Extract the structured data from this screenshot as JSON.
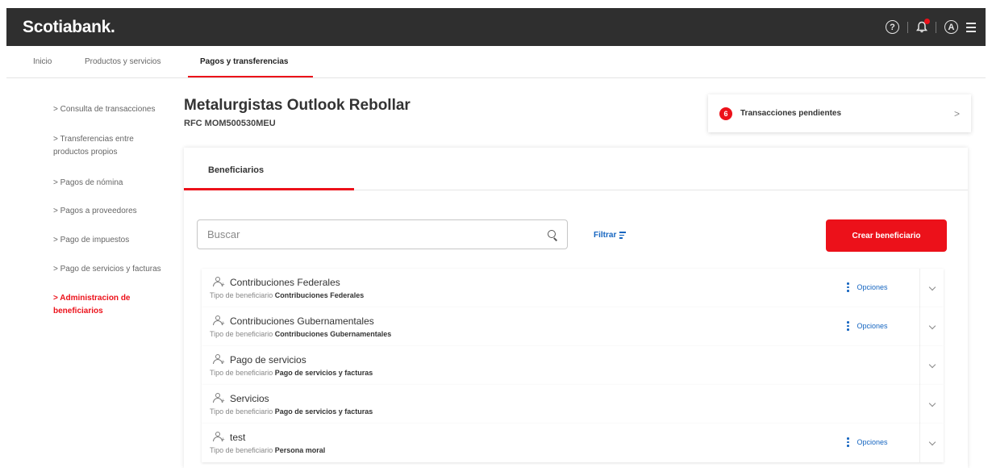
{
  "brand": {
    "name": "Scotiabank."
  },
  "topbar_icons": {
    "help": "?",
    "profile": "A"
  },
  "nav": {
    "items": [
      {
        "label": "Inicio"
      },
      {
        "label": "Productos y servicios"
      },
      {
        "label": "Pagos y transferencias",
        "active": true
      }
    ]
  },
  "sidebar": {
    "items": [
      {
        "label": "> Consulta de transacciones"
      },
      {
        "label": "> Transferencias entre productos propios"
      },
      {
        "label": "> Pagos de nómina"
      },
      {
        "label": "> Pagos a proveedores"
      },
      {
        "label": "> Pago de impuestos"
      },
      {
        "label": "> Pago de servicios y facturas"
      },
      {
        "label": "> Administracion de beneficiarios",
        "active": true
      }
    ]
  },
  "client": {
    "name": "Metalurgistas Outlook Rebollar",
    "rfc": "RFC MOM500530MEU"
  },
  "pending": {
    "count": "6",
    "label": "Transacciones pendientes",
    "chevron": ">"
  },
  "tabs": {
    "active_label": "Beneficiarios"
  },
  "search": {
    "placeholder": "Buscar",
    "value": ""
  },
  "filter": {
    "label": "Filtrar"
  },
  "create_button": {
    "label": "Crear beneficiario"
  },
  "beneficiaries": {
    "type_prefix": "Tipo de beneficiario",
    "options_label": "Opciones",
    "rows": [
      {
        "name": "Contribuciones Federales",
        "type": "Contribuciones Federales",
        "has_options": true
      },
      {
        "name": "Contribuciones Gubernamentales",
        "type": "Contribuciones Gubernamentales",
        "has_options": true
      },
      {
        "name": "Pago de servicios",
        "type": "Pago de servicios y facturas",
        "has_options": false
      },
      {
        "name": "Servicios",
        "type": "Pago de servicios y facturas",
        "has_options": false
      },
      {
        "name": "test",
        "type": "Persona moral",
        "has_options": true
      }
    ]
  },
  "colors": {
    "brand_red": "#ec111a",
    "topbar": "#2f2f2f",
    "link_blue": "#1565c0"
  }
}
